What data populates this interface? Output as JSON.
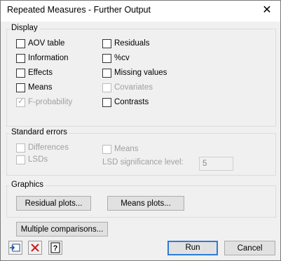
{
  "window": {
    "title": "Repeated Measures - Further Output"
  },
  "display": {
    "legend": "Display",
    "left": [
      {
        "label": "AOV table",
        "checked": false,
        "enabled": true
      },
      {
        "label": "Information",
        "checked": false,
        "enabled": true
      },
      {
        "label": "Effects",
        "checked": false,
        "enabled": true
      },
      {
        "label": "Means",
        "checked": false,
        "enabled": true
      },
      {
        "label": "F-probability",
        "checked": true,
        "enabled": false
      }
    ],
    "right": [
      {
        "label": "Residuals",
        "checked": false,
        "enabled": true
      },
      {
        "label": "%cv",
        "checked": false,
        "enabled": true
      },
      {
        "label": "Missing values",
        "checked": false,
        "enabled": true
      },
      {
        "label": "Covariates",
        "checked": false,
        "enabled": false
      },
      {
        "label": "Contrasts",
        "checked": false,
        "enabled": true
      }
    ]
  },
  "standard_errors": {
    "legend": "Standard errors",
    "differences": "Differences",
    "lsds": "LSDs",
    "means": "Means",
    "lsd_level_label": "LSD significance level:",
    "lsd_level_value": "5"
  },
  "graphics": {
    "legend": "Graphics",
    "residual_plots": "Residual plots...",
    "means_plots": "Means plots..."
  },
  "multiple_comparisons": "Multiple comparisons...",
  "footer": {
    "run": "Run",
    "cancel": "Cancel"
  }
}
